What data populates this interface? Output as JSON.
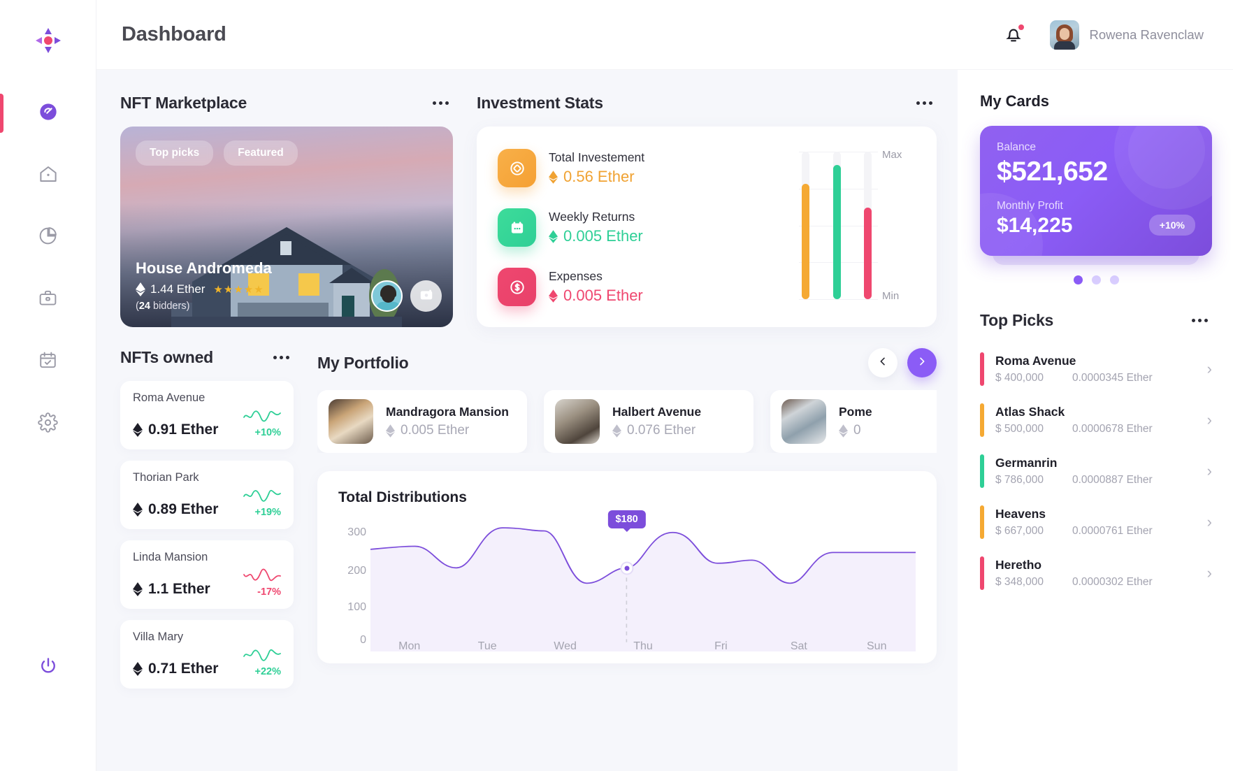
{
  "brand": {
    "logo_icon": "compass-move-logo"
  },
  "sidebar": {
    "items": [
      {
        "icon": "speedometer-icon",
        "name": "dashboard",
        "active": true
      },
      {
        "icon": "home-icon",
        "name": "home",
        "active": false
      },
      {
        "icon": "pie-chart-icon",
        "name": "analytics",
        "active": false
      },
      {
        "icon": "briefcase-icon",
        "name": "portfolio",
        "active": false
      },
      {
        "icon": "calendar-check-icon",
        "name": "calendar",
        "active": false
      },
      {
        "icon": "gear-icon",
        "name": "settings",
        "active": false
      }
    ],
    "power_icon": "power-icon"
  },
  "topbar": {
    "title": "Dashboard",
    "bell_icon": "bell-icon",
    "has_notification": true,
    "user_name": "Rowena Ravenclaw"
  },
  "nft_marketplace": {
    "section_title": "NFT Marketplace",
    "menu_icon": "ellipsis-icon",
    "tags": [
      "Top picks",
      "Featured"
    ],
    "hero": {
      "name": "House Andromeda",
      "price": "1.44 Ether",
      "stars": "★★★★★",
      "bidders_count": "24",
      "bidders_label": "bidders)",
      "bidders_prefix": "(",
      "camera_icon": "camera-icon",
      "avatar_icon": "bidder-avatar"
    }
  },
  "investment_stats": {
    "section_title": "Investment Stats",
    "menu_icon": "ellipsis-icon",
    "rows": [
      {
        "label": "Total Investement",
        "value": "0.56 Ether",
        "color": "orange",
        "icon": "target-icon",
        "hex": "#f0a232"
      },
      {
        "label": "Weekly Returns",
        "value": "0.005 Ether",
        "color": "green",
        "icon": "calendar-icon",
        "hex": "#2ecf96"
      },
      {
        "label": "Expenses",
        "value": "0.005 Ether",
        "color": "red",
        "icon": "dollar-circle-icon",
        "hex": "#ef476f"
      }
    ],
    "axis": {
      "max_label": "Max",
      "min_label": "Min"
    },
    "chart_data": {
      "type": "bar",
      "title": "Investment Stats",
      "categories": [
        "Total Investement",
        "Weekly Returns",
        "Expenses"
      ],
      "values": [
        78,
        91,
        62
      ],
      "colors": [
        "#f5a933",
        "#2ecf96",
        "#ef476f"
      ],
      "ylim": [
        0,
        100
      ],
      "ylabel": "",
      "xlabel": "",
      "tick_labels": [
        "Min",
        "Max"
      ],
      "grid": true,
      "legend": "none"
    }
  },
  "nfts_owned": {
    "section_title": "NFTs owned",
    "menu_icon": "ellipsis-icon",
    "items": [
      {
        "name": "Roma Avenue",
        "price": "0.91 Ether",
        "change": "+10%",
        "dir": "up"
      },
      {
        "name": "Thorian Park",
        "price": "0.89 Ether",
        "change": "+19%",
        "dir": "up"
      },
      {
        "name": "Linda Mansion",
        "price": "1.1 Ether",
        "change": "-17%",
        "dir": "down"
      },
      {
        "name": "Villa Mary",
        "price": "0.71 Ether",
        "change": "+22%",
        "dir": "up"
      }
    ]
  },
  "portfolio": {
    "section_title": "My Portfolio",
    "prev_icon": "chevron-left-icon",
    "next_icon": "chevron-right-icon",
    "items": [
      {
        "name": "Mandragora Mansion",
        "price": "0.005 Ether"
      },
      {
        "name": "Halbert Avenue",
        "price": "0.076 Ether"
      },
      {
        "name": "Pome",
        "price": "0"
      }
    ]
  },
  "distributions": {
    "title": "Total Distributions",
    "chart_data": {
      "type": "area",
      "title": "Total Distributions",
      "xlabel": "",
      "ylabel": "",
      "categories": [
        "Mon",
        "Tue",
        "Wed",
        "Thu",
        "Fri",
        "Sat",
        "Sun"
      ],
      "y_ticks": [
        0,
        100,
        200,
        300
      ],
      "ylim": [
        0,
        360
      ],
      "values": [
        310,
        262,
        352,
        192,
        235,
        340,
        196,
        296
      ],
      "highlight": {
        "category": "Thu",
        "label": "$180",
        "value": 235
      },
      "line_color": "#7c4ddb",
      "fill_color": "#f3effd",
      "grid": false,
      "legend": "none"
    }
  },
  "my_cards": {
    "title": "My Cards",
    "balance_label": "Balance",
    "balance_value": "$521,652",
    "profit_label": "Monthly Profit",
    "profit_value": "$14,225",
    "profit_badge": "+10%",
    "accent_hex": "#8b5cf6",
    "pager": {
      "count": 3,
      "active": 0
    }
  },
  "top_picks": {
    "title": "Top Picks",
    "menu_icon": "ellipsis-icon",
    "items": [
      {
        "name": "Roma Avenue",
        "usd": "$ 400,000",
        "eth": "0.0000345 Ether",
        "hex": "#ef476f"
      },
      {
        "name": "Atlas Shack",
        "usd": "$ 500,000",
        "eth": "0.0000678 Ether",
        "hex": "#f5a933"
      },
      {
        "name": "Germanrin",
        "usd": "$ 786,000",
        "eth": "0.0000887 Ether",
        "hex": "#2ecf96"
      },
      {
        "name": "Heavens",
        "usd": "$ 667,000",
        "eth": "0.0000761 Ether",
        "hex": "#f5a933"
      },
      {
        "name": "Heretho",
        "usd": "$ 348,000",
        "eth": "0.0000302 Ether",
        "hex": "#ef476f"
      }
    ],
    "chevron_icon": "chevron-right-icon"
  }
}
